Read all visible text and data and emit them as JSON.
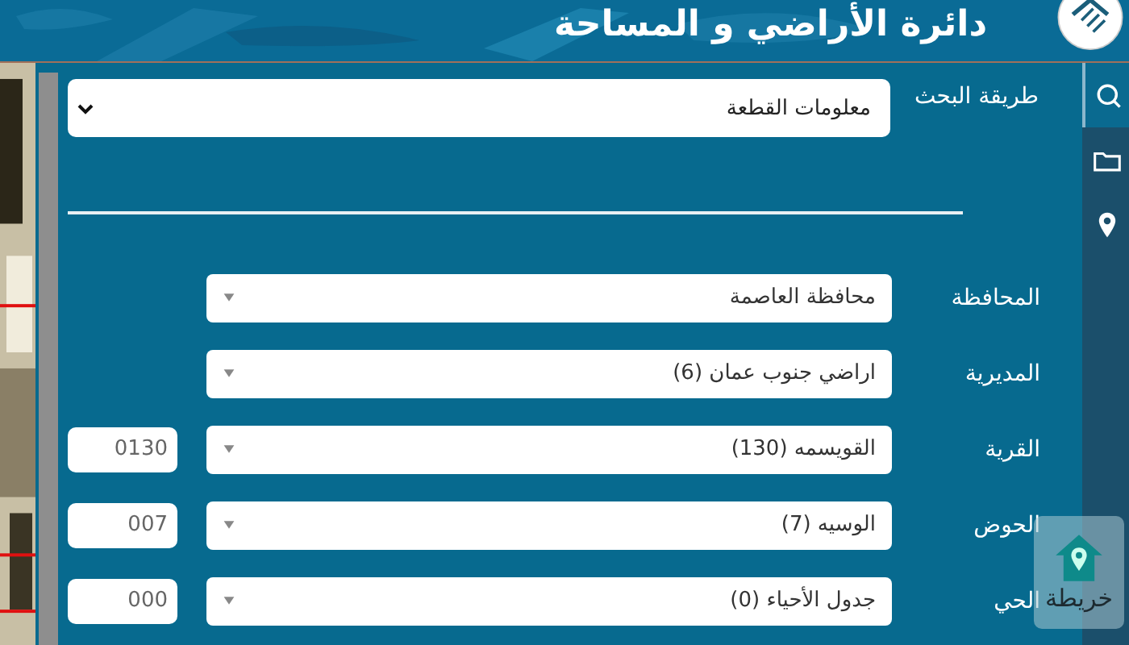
{
  "header": {
    "title": "دائرة الأراضي و المساحة"
  },
  "sidebar": {
    "items": [
      {
        "kind": "search",
        "selected": true
      },
      {
        "kind": "folder",
        "selected": false
      },
      {
        "kind": "pin",
        "selected": false
      }
    ]
  },
  "search_method": {
    "label": "طريقة البحث",
    "value": "معلومات القطعة"
  },
  "fields": [
    {
      "label": "المحافظة",
      "value": "محافظة العاصمة"
    },
    {
      "label": "المديرية",
      "value": "اراضي جنوب عمان (6)"
    },
    {
      "label": "القرية",
      "value": "القويسمه (130)",
      "code": "0130"
    },
    {
      "label": "الحوض",
      "value": "الوسيه (7)",
      "code": "007"
    },
    {
      "label": "الحي",
      "value": "جدول الأحياء (0)",
      "code": "000"
    }
  ],
  "map_button": {
    "label": "خريطة"
  }
}
